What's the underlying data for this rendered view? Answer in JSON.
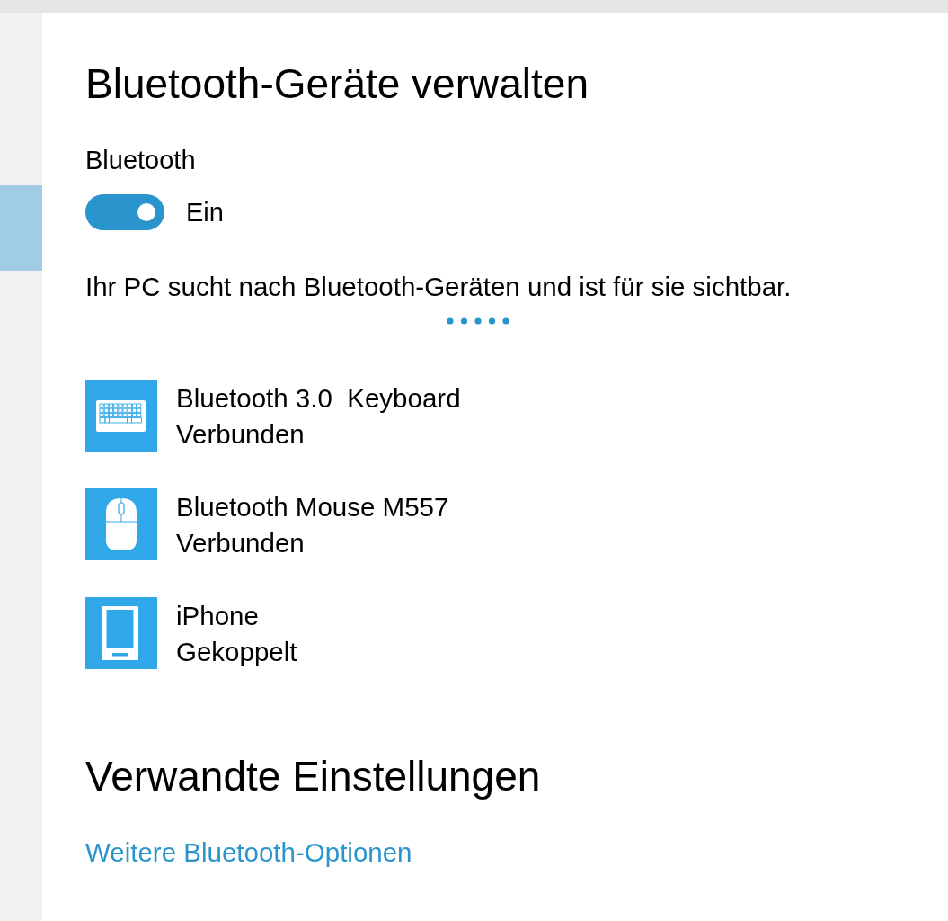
{
  "page": {
    "title": "Bluetooth-Geräte verwalten"
  },
  "bluetooth": {
    "label": "Bluetooth",
    "on": true,
    "state_label": "Ein"
  },
  "status_text": "Ihr PC sucht nach Bluetooth-Geräten und ist für sie sichtbar.",
  "devices": [
    {
      "kind": "keyboard",
      "name": "Bluetooth 3.0  Keyboard",
      "status": "Verbunden"
    },
    {
      "kind": "mouse",
      "name": "Bluetooth Mouse M557",
      "status": "Verbunden"
    },
    {
      "kind": "phone",
      "name": "iPhone",
      "status": "Gekoppelt"
    }
  ],
  "related_settings": {
    "title": "Verwandte Einstellungen",
    "links": [
      "Weitere Bluetooth-Optionen"
    ]
  }
}
